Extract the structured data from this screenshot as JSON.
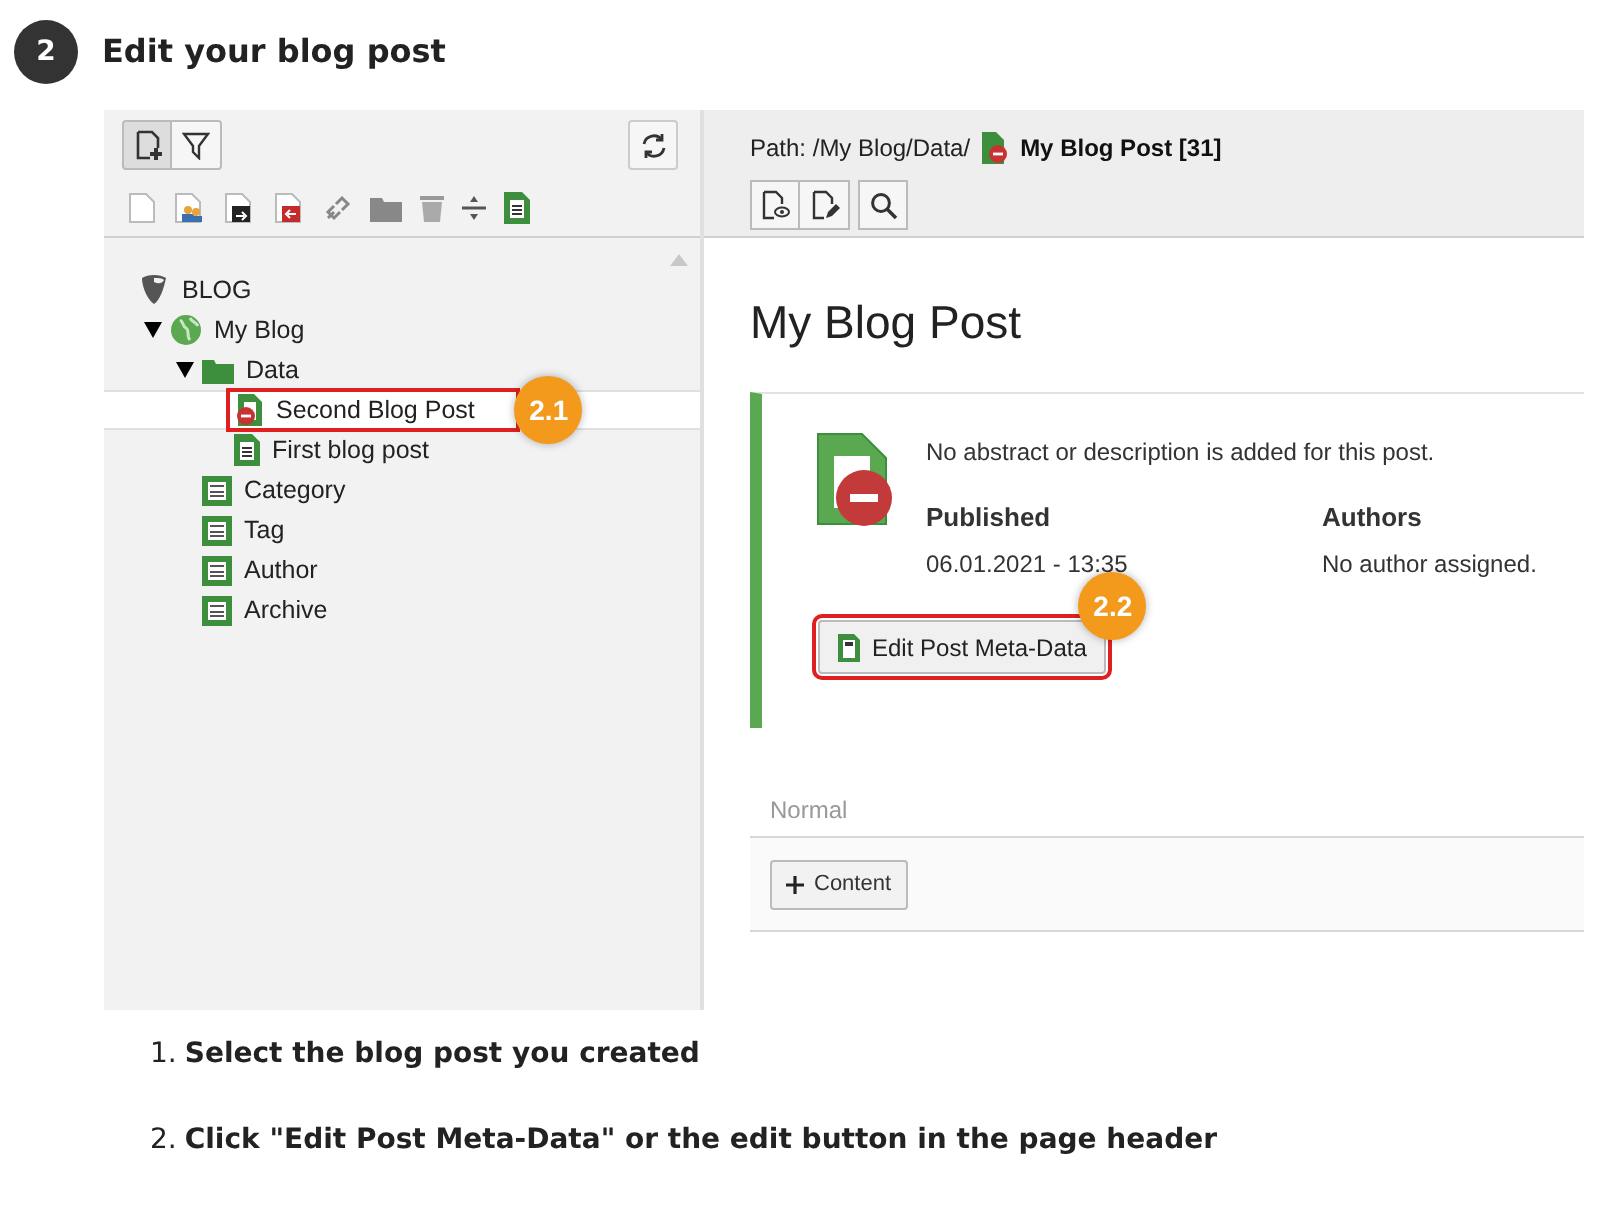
{
  "step": {
    "number": "2",
    "title": "Edit your blog post"
  },
  "page_tree": {
    "items": [
      {
        "label": "BLOG",
        "kind": "root",
        "selected": false,
        "children": [
          {
            "label": "My Blog",
            "kind": "site",
            "expanded": true,
            "selected": false,
            "children": [
              {
                "label": "Data",
                "kind": "folder",
                "expanded": true,
                "selected": false,
                "children": [
                  {
                    "label": "Second Blog Post",
                    "kind": "hidden-post",
                    "selected": true,
                    "callout": "2.1"
                  },
                  {
                    "label": "First blog post",
                    "kind": "post",
                    "selected": false
                  }
                ]
              },
              {
                "label": "Category",
                "kind": "list",
                "selected": false
              },
              {
                "label": "Tag",
                "kind": "list",
                "selected": false
              },
              {
                "label": "Author",
                "kind": "list",
                "selected": false
              },
              {
                "label": "Archive",
                "kind": "list",
                "selected": false
              }
            ]
          }
        ]
      }
    ]
  },
  "docheader": {
    "path_label": "Path: /My Blog/Data/",
    "page_title": "My Blog Post [31]"
  },
  "content": {
    "heading": "My Blog Post",
    "post": {
      "description": "No abstract or description is added for this post.",
      "published_label": "Published",
      "published_value": "06.01.2021 - 13:35",
      "authors_label": "Authors",
      "authors_value": "No author assigned.",
      "edit_button": "Edit Post Meta-Data",
      "callout": "2.2"
    },
    "column": {
      "name": "Normal",
      "add_button": "Content"
    }
  },
  "instructions": [
    {
      "number": "1.",
      "text": "Select the blog post you created"
    },
    {
      "number": "2.",
      "text": "Click \"Edit Post Meta-Data\" or the edit button in the page header"
    }
  ]
}
